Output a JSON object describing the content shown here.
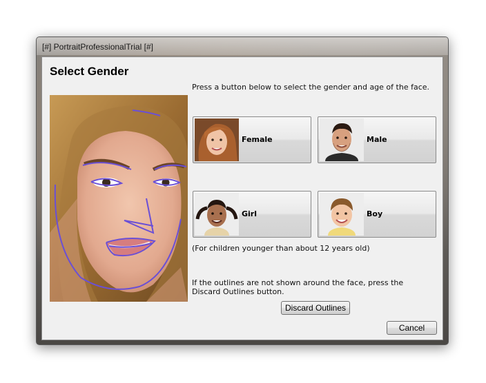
{
  "window": {
    "title": "[#] PortraitProfessionalTrial [#]"
  },
  "dialog": {
    "heading": "Select Gender",
    "instruction": "Press a button below to select the gender and age of the face.",
    "buttons": [
      {
        "label": "Female",
        "icon": "female-face-thumbnail"
      },
      {
        "label": "Male",
        "icon": "male-face-thumbnail"
      },
      {
        "label": "Girl",
        "icon": "girl-face-thumbnail"
      },
      {
        "label": "Boy",
        "icon": "boy-face-thumbnail"
      }
    ],
    "children_note": "(For children younger than about 12 years old)",
    "outlines_note": "If the outlines are not shown around the face, press the Discard Outlines button.",
    "discard_label": "Discard Outlines",
    "cancel_label": "Cancel"
  },
  "colors": {
    "outline": "#6a4fd6",
    "client_bg": "#f0f0f0"
  }
}
